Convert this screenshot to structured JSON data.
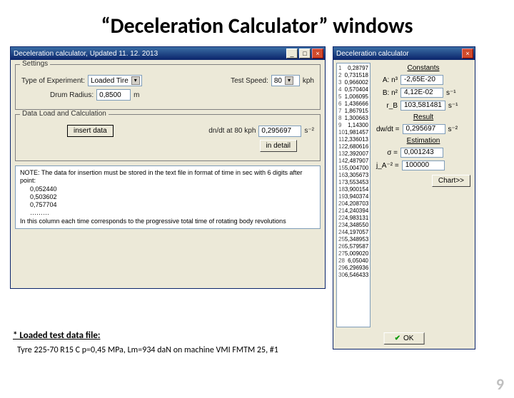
{
  "slide": {
    "title": "“Deceleration Calculator” windows",
    "page": "9"
  },
  "main_window": {
    "title": "Deceleration calculator, Updated 11. 12. 2013",
    "settings_legend": "Settings",
    "type_label": "Type of Experiment:",
    "type_value": "Loaded Tire",
    "speed_label": "Test Speed:",
    "speed_value": "80",
    "speed_unit": "kph",
    "radius_label": "Drum Radius:",
    "radius_value": "0,8500",
    "radius_unit": "m",
    "data_legend": "Data Load and Calculation",
    "insert_btn": "insert data",
    "dv_label": "dn/dt at 80 kph",
    "dv_value": "0,295697",
    "dv_unit": "s⁻²",
    "detail_btn": "in detail",
    "note_head": "NOTE: The data for insertion must be stored in the text file in format of time in sec with 6 digits after point:",
    "note_l1": "0,052440",
    "note_l2": "0,503602",
    "note_l3": "0,757704",
    "note_dots": "………",
    "note_foot": "In this column each time corresponds to the progressive total time of rotating body revolutions"
  },
  "sub_window": {
    "title": "Deceleration calculator",
    "constants_head": "Constants",
    "a_label": "A: n³",
    "a_val": "-2,65E-20",
    "b_label": "B: n²",
    "b_val": "4,12E-02",
    "c_label": "r_B",
    "c_val": "103,581481",
    "c_unit": "s⁻¹",
    "result_head": "Result",
    "dw_label": "dw/dt =",
    "dw_val": "0,295697",
    "dw_unit": "s⁻²",
    "est_head": "Estimation",
    "sig_label": "σ =",
    "sig_val": "0,001243",
    "j_label": "j_A⁻² =",
    "j_val": "100000",
    "chart_btn": "Chart>>",
    "ok": "OK",
    "list": [
      "0,28797",
      "0,731518",
      "0,966002",
      "0,570404",
      "1,006095",
      "1,436666",
      "1,867915",
      "1,300663",
      "1,14300",
      "1,981457",
      "2,336013",
      "2,680616",
      "2,392007",
      "2,487907",
      "5,004700",
      "3,305673",
      "3,553453",
      "3,900154",
      "3,940374",
      "4,208703",
      "4,240394",
      "4,983131",
      "4,348550",
      "4,197057",
      "5,348953",
      "5,579587",
      "5,009020",
      "6,05040",
      "6,296936",
      "6,546433"
    ]
  },
  "footer": {
    "label": "* Loaded test data file:",
    "detail": "Tyre 225-70 R15 C p=0,45 MPa, Lm=934 daN on machine VMI FMTM 25, #1"
  }
}
